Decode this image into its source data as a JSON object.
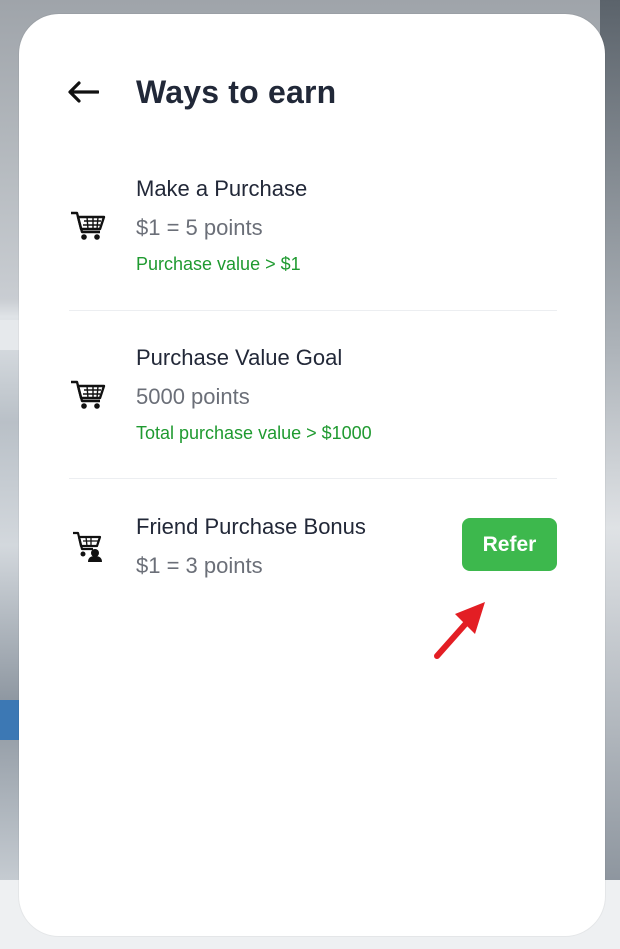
{
  "header": {
    "back_icon": "left-arrow-icon",
    "title": "Ways to earn"
  },
  "earn_items": [
    {
      "icon": "shopping-cart-icon",
      "name": "Make a Purchase",
      "points": "$1 = 5 points",
      "condition": "Purchase value > $1"
    },
    {
      "icon": "shopping-cart-icon",
      "name": "Purchase Value Goal",
      "points": "5000 points",
      "condition": "Total purchase value > $1000"
    },
    {
      "icon": "cart-with-user-icon",
      "name": "Friend Purchase Bonus",
      "points": "$1 = 3 points",
      "action_label": "Refer"
    }
  ],
  "colors": {
    "title": "#212838",
    "condition_text": "#1f9a30",
    "refer_button": "#3db84d",
    "annotation_arrow": "#e31e24"
  },
  "annotation": {
    "icon": "red-pointer-arrow-icon"
  }
}
